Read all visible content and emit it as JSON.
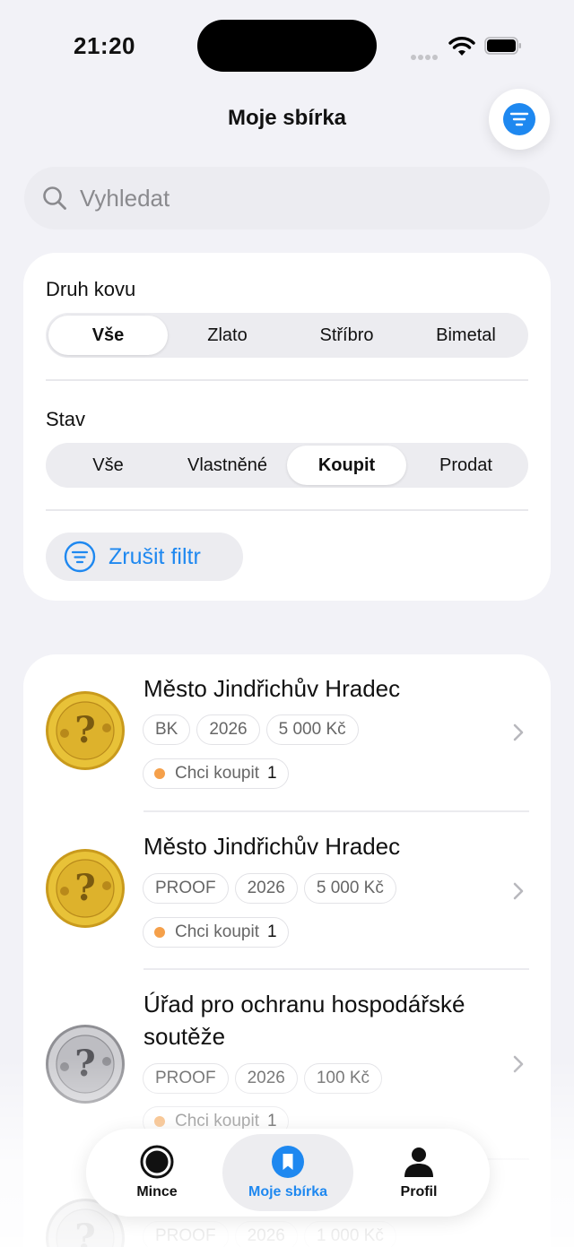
{
  "status_bar": {
    "time": "21:20"
  },
  "header": {
    "title": "Moje sbírka"
  },
  "search": {
    "placeholder": "Vyhledat"
  },
  "filters": {
    "metal": {
      "label": "Druh kovu",
      "options": [
        "Vše",
        "Zlato",
        "Stříbro",
        "Bimetal"
      ],
      "selected": "Vše"
    },
    "state": {
      "label": "Stav",
      "options": [
        "Vše",
        "Vlastněné",
        "Koupit",
        "Prodat"
      ],
      "selected": "Koupit"
    },
    "clear_label": "Zrušit filtr"
  },
  "coins": [
    {
      "title": "Město Jindřichův Hradec",
      "tags": [
        "BK",
        "2026",
        "5 000 Kč"
      ],
      "status": "Chci koupit",
      "count": "1",
      "metal": "gold"
    },
    {
      "title": "Město Jindřichův Hradec",
      "tags": [
        "PROOF",
        "2026",
        "5 000 Kč"
      ],
      "status": "Chci koupit",
      "count": "1",
      "metal": "gold"
    },
    {
      "title": "Úřad pro ochranu hospodářské soutěže",
      "tags": [
        "PROOF",
        "2026",
        "100 Kč"
      ],
      "status": "Chci koupit",
      "count": "1",
      "metal": "silver"
    },
    {
      "title": "",
      "tags": [
        "PROOF",
        "2026",
        "1 000 Kč"
      ],
      "status": "",
      "count": "",
      "metal": "silver"
    }
  ],
  "tabbar": {
    "items": [
      {
        "label": "Mince",
        "icon": "coin-icon"
      },
      {
        "label": "Moje sbírka",
        "icon": "bookmark-icon"
      },
      {
        "label": "Profil",
        "icon": "person-icon"
      }
    ],
    "active": "Moje sbírka"
  },
  "colors": {
    "accent": "#1e88f0",
    "status_dot": "#f5a04a",
    "background": "#f2f2f7"
  }
}
